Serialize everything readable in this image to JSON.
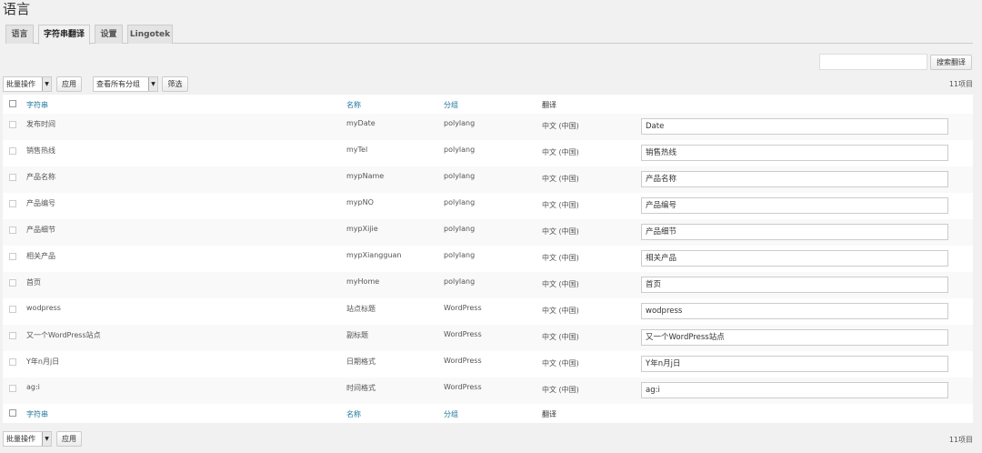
{
  "page": {
    "title": "语言"
  },
  "tabs": [
    {
      "label": "语言"
    },
    {
      "label": "字符串翻译"
    },
    {
      "label": "设置"
    },
    {
      "label": "Lingotek"
    }
  ],
  "search": {
    "button_label": "搜索翻译",
    "value": ""
  },
  "top_actions": {
    "bulk_label": "批量操作",
    "apply_label": "应用",
    "group_filter_label": "查看所有分组",
    "filter_label": "筛选",
    "count_label": "11项目"
  },
  "table": {
    "headers": {
      "string": "字符串",
      "name": "名称",
      "group": "分组",
      "translation": "翻译"
    },
    "rows": [
      {
        "string": "发布时间",
        "name": "myDate",
        "group": "polylang",
        "language": "中文 (中国)",
        "translation": "Date"
      },
      {
        "string": "销售热线",
        "name": "myTel",
        "group": "polylang",
        "language": "中文 (中国)",
        "translation": "销售热线"
      },
      {
        "string": "产品名称",
        "name": "mypName",
        "group": "polylang",
        "language": "中文 (中国)",
        "translation": "产品名称"
      },
      {
        "string": "产品编号",
        "name": "mypNO",
        "group": "polylang",
        "language": "中文 (中国)",
        "translation": "产品编号"
      },
      {
        "string": "产品细节",
        "name": "mypXijie",
        "group": "polylang",
        "language": "中文 (中国)",
        "translation": "产品细节"
      },
      {
        "string": "相关产品",
        "name": "mypXiangguan",
        "group": "polylang",
        "language": "中文 (中国)",
        "translation": "相关产品"
      },
      {
        "string": "首页",
        "name": "myHome",
        "group": "polylang",
        "language": "中文 (中国)",
        "translation": "首页"
      },
      {
        "string": "wodpress",
        "name": "站点标题",
        "group": "WordPress",
        "language": "中文 (中国)",
        "translation": "wodpress"
      },
      {
        "string": "又一个WordPress站点",
        "name": "副标题",
        "group": "WordPress",
        "language": "中文 (中国)",
        "translation": "又一个WordPress站点"
      },
      {
        "string": "Y年n月j日",
        "name": "日期格式",
        "group": "WordPress",
        "language": "中文 (中国)",
        "translation": "Y年n月j日"
      },
      {
        "string": "ag:i",
        "name": "时间格式",
        "group": "WordPress",
        "language": "中文 (中国)",
        "translation": "ag:i"
      }
    ]
  },
  "bottom_actions": {
    "bulk_label": "批量操作",
    "apply_label": "应用",
    "count_label": "11项目"
  }
}
